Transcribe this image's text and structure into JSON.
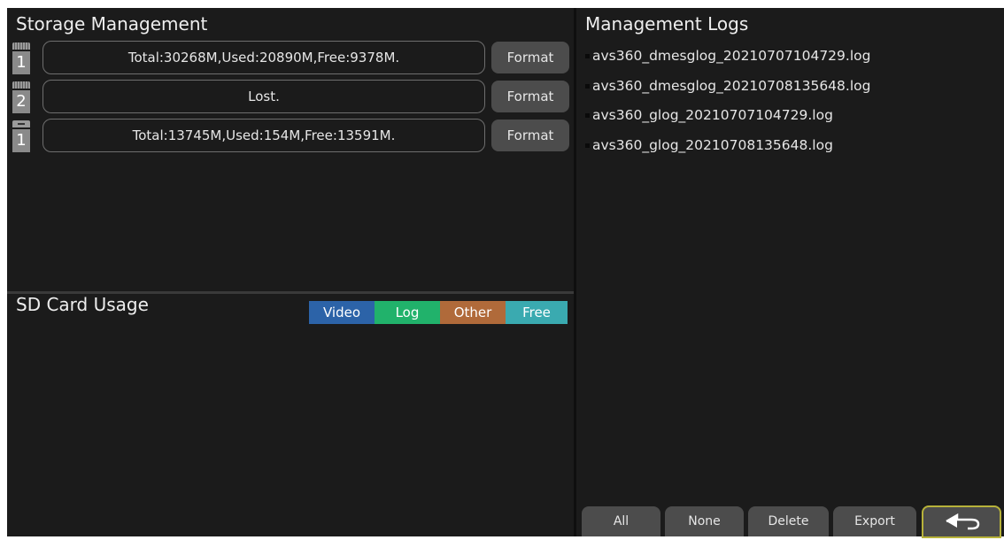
{
  "storage": {
    "title": "Storage Management",
    "devices": [
      {
        "type": "sd",
        "number": "1",
        "info": "Total:30268M,Used:20890M,Free:9378M.",
        "format_label": "Format"
      },
      {
        "type": "sd",
        "number": "2",
        "info": "Lost.",
        "format_label": "Format"
      },
      {
        "type": "usb",
        "number": "1",
        "info": "Total:13745M,Used:154M,Free:13591M.",
        "format_label": "Format"
      }
    ]
  },
  "usage": {
    "title": "SD Card Usage",
    "legend": [
      {
        "label": "Video",
        "color": "#2c63a8"
      },
      {
        "label": "Log",
        "color": "#21b26b"
      },
      {
        "label": "Other",
        "color": "#b06a3a"
      },
      {
        "label": "Free",
        "color": "#3aaab0"
      }
    ]
  },
  "logs": {
    "title": "Management Logs",
    "items": [
      "avs360_dmesglog_20210707104729.log",
      "avs360_dmesglog_20210708135648.log",
      "avs360_glog_20210707104729.log",
      "avs360_glog_20210708135648.log"
    ],
    "buttons": {
      "all": "All",
      "none": "None",
      "delete": "Delete",
      "export": "Export"
    },
    "back_icon": "back-arrow-icon"
  }
}
